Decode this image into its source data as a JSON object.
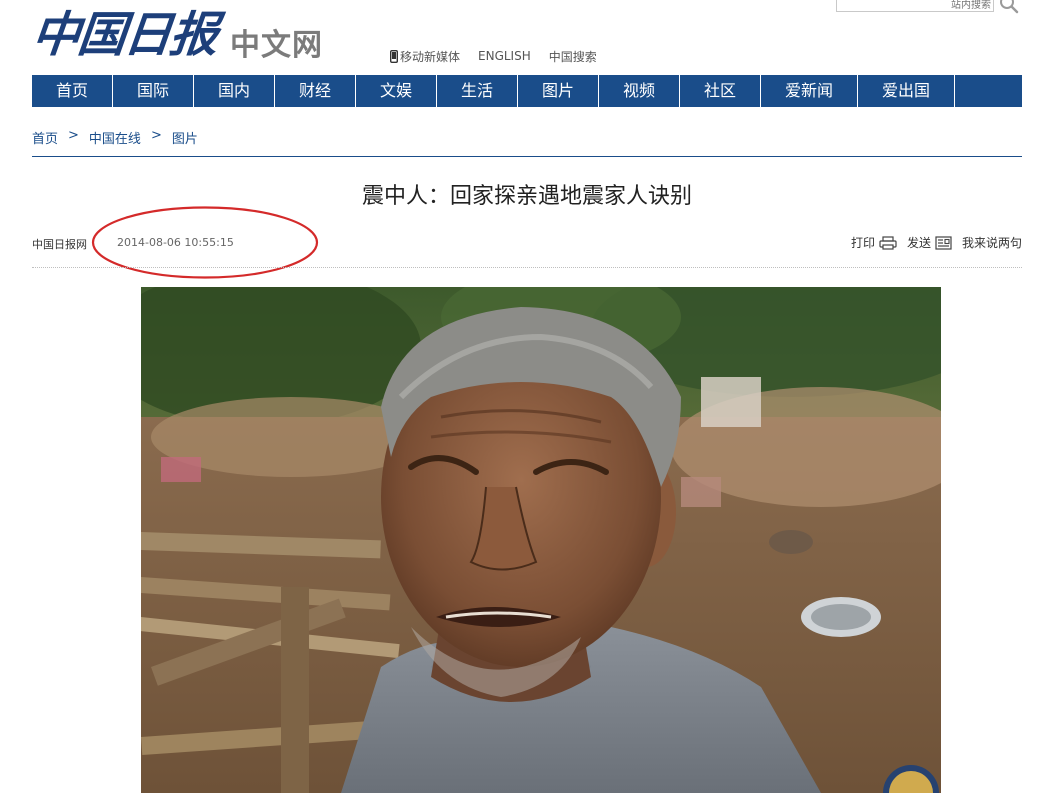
{
  "header": {
    "logo_main": "中国日报",
    "logo_sub": "中文网",
    "search_placeholder": "站内搜索",
    "top_links": [
      "移动新媒体",
      "ENGLISH",
      "中国搜索"
    ]
  },
  "nav": {
    "items": [
      "首页",
      "国际",
      "国内",
      "财经",
      "文娱",
      "生活",
      "图片",
      "视频",
      "社区",
      "爱新闻",
      "爱出国"
    ]
  },
  "breadcrumb": {
    "items": [
      "首页",
      "中国在线",
      "图片"
    ],
    "separator": ">"
  },
  "article": {
    "title": "震中人：回家探亲遇地震家人诀别",
    "source": "中国日报网",
    "timestamp": "2014-08-06 10:55:15",
    "tools": {
      "print": "打印",
      "send": "发送",
      "comment": "我来说两句"
    }
  },
  "colors": {
    "brand_blue": "#1a4d8a",
    "annotation_red": "#d42a2a"
  }
}
